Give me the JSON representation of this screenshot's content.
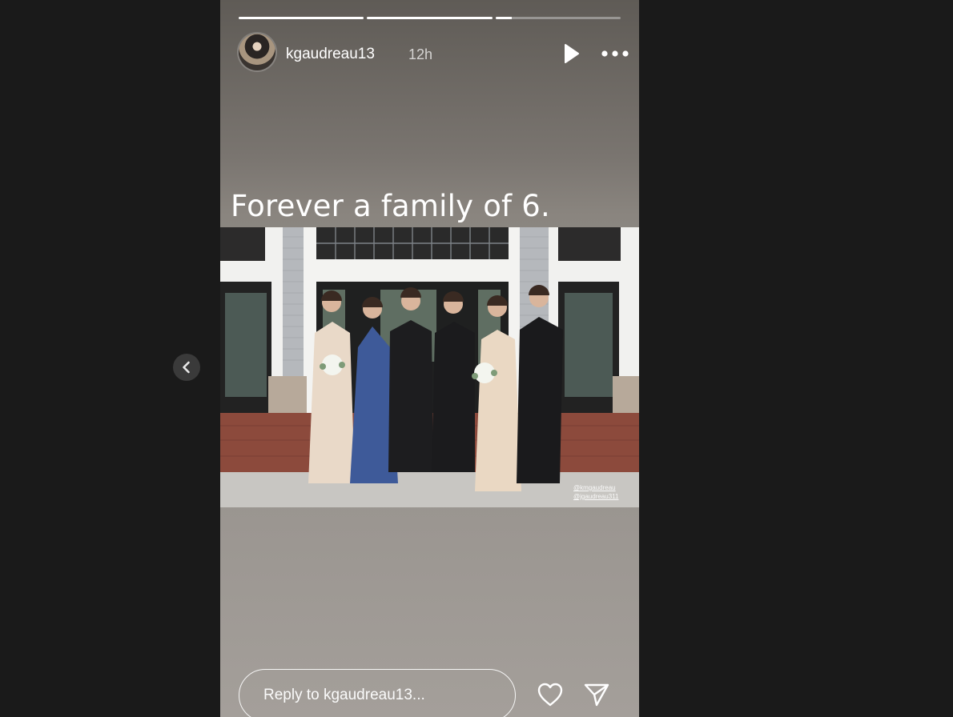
{
  "story": {
    "progress": [
      1,
      1,
      0.13
    ],
    "username": "kgaudreau13",
    "time": "12h",
    "caption": "Forever a family of 6.",
    "photo_credits": [
      "@kmgaudreau",
      "@jgaudreau311"
    ],
    "reply_placeholder": "Reply to kgaudreau13...",
    "icons": {
      "avatar": "profile-photo",
      "play": "play-icon",
      "more": "more-horizontal-icon",
      "like": "heart-icon",
      "share": "send-icon",
      "previous": "chevron-left-icon"
    }
  },
  "colors": {
    "page_background": "#1a1a1a",
    "story_background": "#8a857f",
    "text": "#ffffff"
  }
}
